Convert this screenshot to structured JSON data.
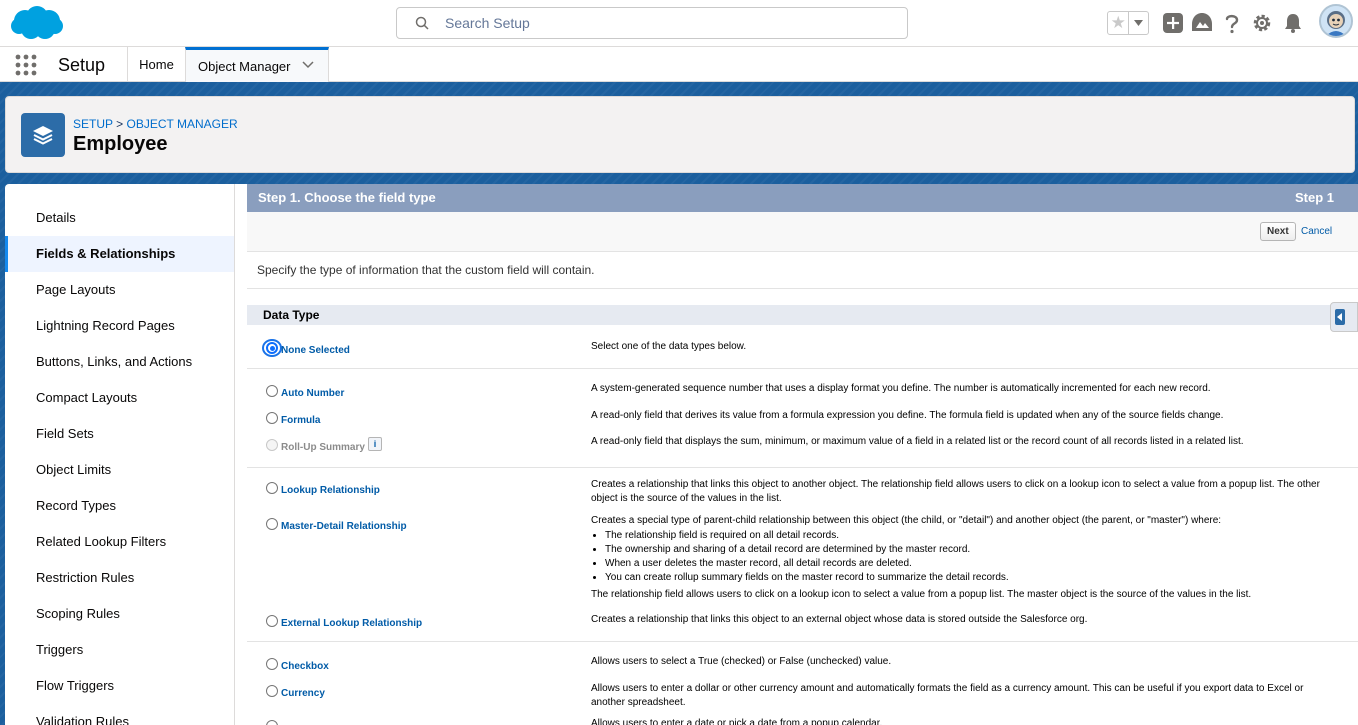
{
  "header": {
    "search_placeholder": "Search Setup"
  },
  "nav": {
    "app_name": "Setup",
    "tabs": [
      {
        "label": "Home"
      },
      {
        "label": "Object Manager"
      }
    ]
  },
  "page": {
    "breadcrumb_root": "SETUP",
    "breadcrumb_sep": ">",
    "breadcrumb_current": "OBJECT MANAGER",
    "title": "Employee"
  },
  "left_nav": {
    "items": [
      "Details",
      "Fields & Relationships",
      "Page Layouts",
      "Lightning Record Pages",
      "Buttons, Links, and Actions",
      "Compact Layouts",
      "Field Sets",
      "Object Limits",
      "Record Types",
      "Related Lookup Filters",
      "Restriction Rules",
      "Scoping Rules",
      "Triggers",
      "Flow Triggers",
      "Validation Rules"
    ],
    "active_index": 1
  },
  "wizard": {
    "step_title": "Step 1. Choose the field type",
    "step_label": "Step 1",
    "next_label": "Next",
    "cancel_label": "Cancel",
    "instruction": "Specify the type of information that the custom field will contain.",
    "section_title": "Data Type",
    "info_glyph": "i"
  },
  "data_types": {
    "none_selected": {
      "label": "None Selected",
      "desc": "Select one of the data types below."
    },
    "auto_number": {
      "label": "Auto Number",
      "desc": "A system-generated sequence number that uses a display format you define. The number is automatically incremented for each new record."
    },
    "formula": {
      "label": "Formula",
      "desc": "A read-only field that derives its value from a formula expression you define. The formula field is updated when any of the source fields change."
    },
    "rollup": {
      "label": "Roll-Up Summary",
      "desc": "A read-only field that displays the sum, minimum, or maximum value of a field in a related list or the record count of all records listed in a related list."
    },
    "lookup": {
      "label": "Lookup Relationship",
      "desc": "Creates a relationship that links this object to another object. The relationship field allows users to click on a lookup icon to select a value from a popup list. The other object is the source of the values in the list."
    },
    "master_detail": {
      "label": "Master-Detail Relationship",
      "desc": "Creates a special type of parent-child relationship between this object (the child, or \"detail\") and another object (the parent, or \"master\") where:",
      "bullets": [
        "The relationship field is required on all detail records.",
        "The ownership and sharing of a detail record are determined by the master record.",
        "When a user deletes the master record, all detail records are deleted.",
        "You can create rollup summary fields on the master record to summarize the detail records."
      ],
      "desc_after": "The relationship field allows users to click on a lookup icon to select a value from a popup list. The master object is the source of the values in the list."
    },
    "external_lookup": {
      "label": "External Lookup Relationship",
      "desc": "Creates a relationship that links this object to an external object whose data is stored outside the Salesforce org."
    },
    "checkbox": {
      "label": "Checkbox",
      "desc": "Allows users to select a True (checked) or False (unchecked) value."
    },
    "currency": {
      "label": "Currency",
      "desc": "Allows users to enter a dollar or other currency amount and automatically formats the field as a currency amount. This can be useful if you export data to Excel or another spreadsheet."
    },
    "date": {
      "label": "Date",
      "desc": "Allows users to enter a date or pick a date from a popup calendar."
    }
  },
  "colors": {
    "brand_blue": "#1b5f9e",
    "step_bar": "#8a9ebe",
    "link": "#015ba7"
  }
}
